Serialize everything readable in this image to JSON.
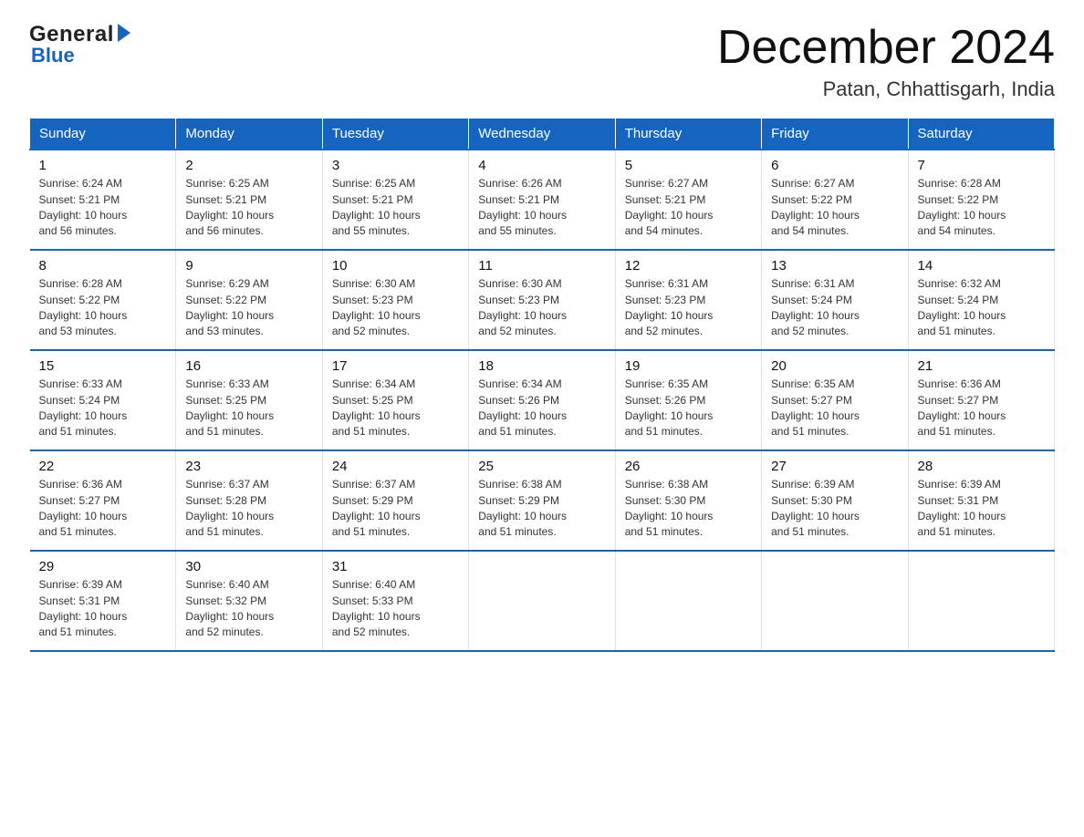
{
  "header": {
    "logo_general": "General",
    "logo_blue": "Blue",
    "month_title": "December 2024",
    "location": "Patan, Chhattisgarh, India"
  },
  "columns": [
    "Sunday",
    "Monday",
    "Tuesday",
    "Wednesday",
    "Thursday",
    "Friday",
    "Saturday"
  ],
  "weeks": [
    [
      {
        "day": "1",
        "sunrise": "6:24 AM",
        "sunset": "5:21 PM",
        "daylight": "10 hours and 56 minutes."
      },
      {
        "day": "2",
        "sunrise": "6:25 AM",
        "sunset": "5:21 PM",
        "daylight": "10 hours and 56 minutes."
      },
      {
        "day": "3",
        "sunrise": "6:25 AM",
        "sunset": "5:21 PM",
        "daylight": "10 hours and 55 minutes."
      },
      {
        "day": "4",
        "sunrise": "6:26 AM",
        "sunset": "5:21 PM",
        "daylight": "10 hours and 55 minutes."
      },
      {
        "day": "5",
        "sunrise": "6:27 AM",
        "sunset": "5:21 PM",
        "daylight": "10 hours and 54 minutes."
      },
      {
        "day": "6",
        "sunrise": "6:27 AM",
        "sunset": "5:22 PM",
        "daylight": "10 hours and 54 minutes."
      },
      {
        "day": "7",
        "sunrise": "6:28 AM",
        "sunset": "5:22 PM",
        "daylight": "10 hours and 54 minutes."
      }
    ],
    [
      {
        "day": "8",
        "sunrise": "6:28 AM",
        "sunset": "5:22 PM",
        "daylight": "10 hours and 53 minutes."
      },
      {
        "day": "9",
        "sunrise": "6:29 AM",
        "sunset": "5:22 PM",
        "daylight": "10 hours and 53 minutes."
      },
      {
        "day": "10",
        "sunrise": "6:30 AM",
        "sunset": "5:23 PM",
        "daylight": "10 hours and 52 minutes."
      },
      {
        "day": "11",
        "sunrise": "6:30 AM",
        "sunset": "5:23 PM",
        "daylight": "10 hours and 52 minutes."
      },
      {
        "day": "12",
        "sunrise": "6:31 AM",
        "sunset": "5:23 PM",
        "daylight": "10 hours and 52 minutes."
      },
      {
        "day": "13",
        "sunrise": "6:31 AM",
        "sunset": "5:24 PM",
        "daylight": "10 hours and 52 minutes."
      },
      {
        "day": "14",
        "sunrise": "6:32 AM",
        "sunset": "5:24 PM",
        "daylight": "10 hours and 51 minutes."
      }
    ],
    [
      {
        "day": "15",
        "sunrise": "6:33 AM",
        "sunset": "5:24 PM",
        "daylight": "10 hours and 51 minutes."
      },
      {
        "day": "16",
        "sunrise": "6:33 AM",
        "sunset": "5:25 PM",
        "daylight": "10 hours and 51 minutes."
      },
      {
        "day": "17",
        "sunrise": "6:34 AM",
        "sunset": "5:25 PM",
        "daylight": "10 hours and 51 minutes."
      },
      {
        "day": "18",
        "sunrise": "6:34 AM",
        "sunset": "5:26 PM",
        "daylight": "10 hours and 51 minutes."
      },
      {
        "day": "19",
        "sunrise": "6:35 AM",
        "sunset": "5:26 PM",
        "daylight": "10 hours and 51 minutes."
      },
      {
        "day": "20",
        "sunrise": "6:35 AM",
        "sunset": "5:27 PM",
        "daylight": "10 hours and 51 minutes."
      },
      {
        "day": "21",
        "sunrise": "6:36 AM",
        "sunset": "5:27 PM",
        "daylight": "10 hours and 51 minutes."
      }
    ],
    [
      {
        "day": "22",
        "sunrise": "6:36 AM",
        "sunset": "5:27 PM",
        "daylight": "10 hours and 51 minutes."
      },
      {
        "day": "23",
        "sunrise": "6:37 AM",
        "sunset": "5:28 PM",
        "daylight": "10 hours and 51 minutes."
      },
      {
        "day": "24",
        "sunrise": "6:37 AM",
        "sunset": "5:29 PM",
        "daylight": "10 hours and 51 minutes."
      },
      {
        "day": "25",
        "sunrise": "6:38 AM",
        "sunset": "5:29 PM",
        "daylight": "10 hours and 51 minutes."
      },
      {
        "day": "26",
        "sunrise": "6:38 AM",
        "sunset": "5:30 PM",
        "daylight": "10 hours and 51 minutes."
      },
      {
        "day": "27",
        "sunrise": "6:39 AM",
        "sunset": "5:30 PM",
        "daylight": "10 hours and 51 minutes."
      },
      {
        "day": "28",
        "sunrise": "6:39 AM",
        "sunset": "5:31 PM",
        "daylight": "10 hours and 51 minutes."
      }
    ],
    [
      {
        "day": "29",
        "sunrise": "6:39 AM",
        "sunset": "5:31 PM",
        "daylight": "10 hours and 51 minutes."
      },
      {
        "day": "30",
        "sunrise": "6:40 AM",
        "sunset": "5:32 PM",
        "daylight": "10 hours and 52 minutes."
      },
      {
        "day": "31",
        "sunrise": "6:40 AM",
        "sunset": "5:33 PM",
        "daylight": "10 hours and 52 minutes."
      },
      null,
      null,
      null,
      null
    ]
  ],
  "labels": {
    "sunrise": "Sunrise:",
    "sunset": "Sunset:",
    "daylight": "Daylight:"
  }
}
